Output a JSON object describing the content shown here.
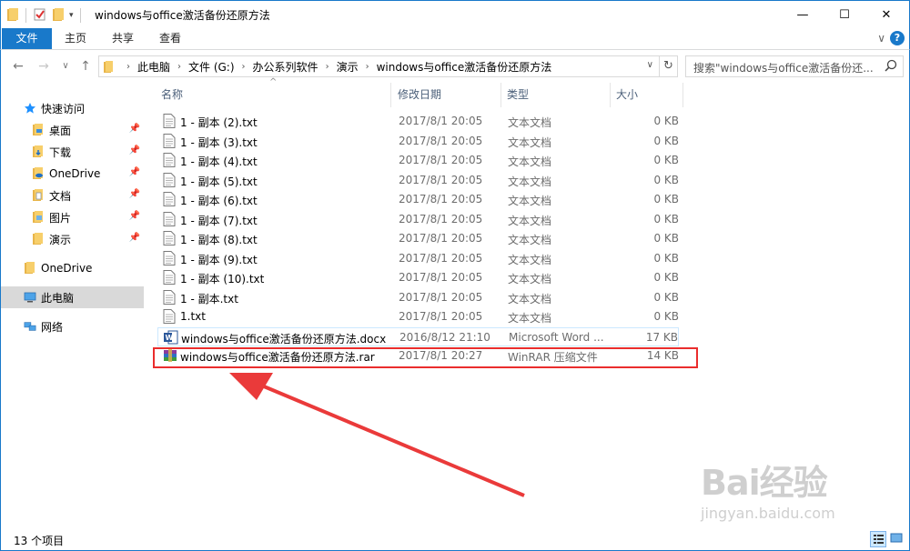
{
  "window": {
    "title": "windows与office激活备份还原方法",
    "minimize": "—",
    "maximize": "☐",
    "close": "✕"
  },
  "ribbon": {
    "tabs": [
      "文件",
      "主页",
      "共享",
      "查看"
    ],
    "help": "?"
  },
  "address": {
    "crumbs": [
      "此电脑",
      "文件 (G:)",
      "办公系列软件",
      "演示",
      "windows与office激活备份还原方法"
    ],
    "search_placeholder": "搜索\"windows与office激活备份还..."
  },
  "nav": {
    "quick_access": "快速访问",
    "items": [
      {
        "label": "桌面",
        "pinned": true
      },
      {
        "label": "下载",
        "pinned": true
      },
      {
        "label": "OneDrive",
        "pinned": true
      },
      {
        "label": "文档",
        "pinned": true
      },
      {
        "label": "图片",
        "pinned": true
      },
      {
        "label": "演示",
        "pinned": false
      }
    ],
    "onedrive": "OneDrive",
    "this_pc": "此电脑",
    "network": "网络"
  },
  "columns": {
    "name": "名称",
    "date": "修改日期",
    "type": "类型",
    "size": "大小"
  },
  "files": [
    {
      "name": "1 - 副本 (2).txt",
      "date": "2017/8/1 20:05",
      "type": "文本文档",
      "size": "0 KB",
      "icon": "txt"
    },
    {
      "name": "1 - 副本 (3).txt",
      "date": "2017/8/1 20:05",
      "type": "文本文档",
      "size": "0 KB",
      "icon": "txt"
    },
    {
      "name": "1 - 副本 (4).txt",
      "date": "2017/8/1 20:05",
      "type": "文本文档",
      "size": "0 KB",
      "icon": "txt"
    },
    {
      "name": "1 - 副本 (5).txt",
      "date": "2017/8/1 20:05",
      "type": "文本文档",
      "size": "0 KB",
      "icon": "txt"
    },
    {
      "name": "1 - 副本 (6).txt",
      "date": "2017/8/1 20:05",
      "type": "文本文档",
      "size": "0 KB",
      "icon": "txt"
    },
    {
      "name": "1 - 副本 (7).txt",
      "date": "2017/8/1 20:05",
      "type": "文本文档",
      "size": "0 KB",
      "icon": "txt"
    },
    {
      "name": "1 - 副本 (8).txt",
      "date": "2017/8/1 20:05",
      "type": "文本文档",
      "size": "0 KB",
      "icon": "txt"
    },
    {
      "name": "1 - 副本 (9).txt",
      "date": "2017/8/1 20:05",
      "type": "文本文档",
      "size": "0 KB",
      "icon": "txt"
    },
    {
      "name": "1 - 副本 (10).txt",
      "date": "2017/8/1 20:05",
      "type": "文本文档",
      "size": "0 KB",
      "icon": "txt"
    },
    {
      "name": "1 - 副本.txt",
      "date": "2017/8/1 20:05",
      "type": "文本文档",
      "size": "0 KB",
      "icon": "txt"
    },
    {
      "name": "1.txt",
      "date": "2017/8/1 20:05",
      "type": "文本文档",
      "size": "0 KB",
      "icon": "txt"
    },
    {
      "name": "windows与office激活备份还原方法.docx",
      "date": "2016/8/12 21:10",
      "type": "Microsoft Word ...",
      "size": "17 KB",
      "icon": "docx"
    },
    {
      "name": "windows与office激活备份还原方法.rar",
      "date": "2017/8/1 20:27",
      "type": "WinRAR 压缩文件",
      "size": "14 KB",
      "icon": "rar"
    }
  ],
  "status": {
    "count": "13 个项目"
  },
  "watermark": {
    "brand": "Bai经验",
    "url": "jingyan.baidu.com"
  },
  "colors": {
    "accent": "#1979ca",
    "highlight": "#ea2d2d",
    "arrow": "#ea3a3a"
  }
}
